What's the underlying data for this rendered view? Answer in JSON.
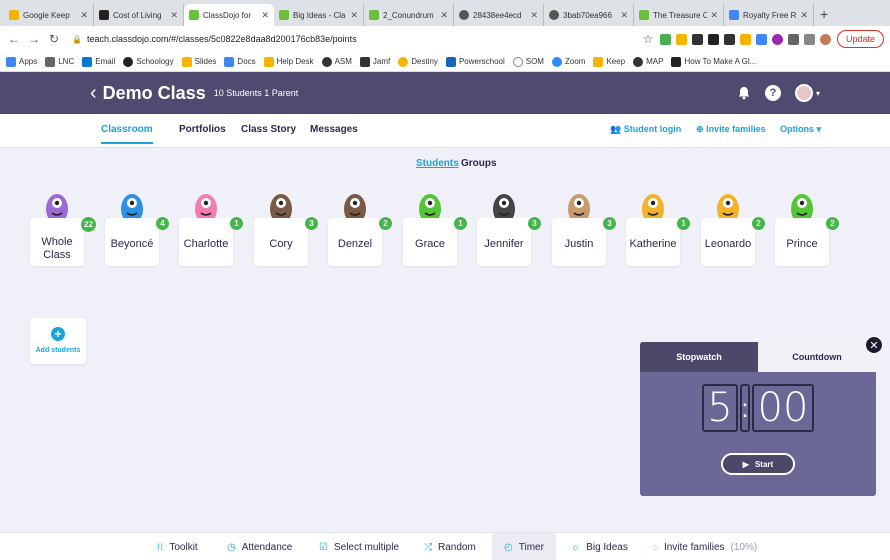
{
  "browser": {
    "tabs": [
      {
        "title": "Google Keep",
        "color": "#f4b400"
      },
      {
        "title": "Cost of Living",
        "color": "#222"
      },
      {
        "title": "ClassDojo for",
        "color": "#6bbf3b"
      },
      {
        "title": "Big Ideas - Cla",
        "color": "#6bbf3b"
      },
      {
        "title": "2_Conundrum",
        "color": "#6bbf3b"
      },
      {
        "title": "28438ee4ecd",
        "color": "#555"
      },
      {
        "title": "3bab70ea966",
        "color": "#555"
      },
      {
        "title": "The Treasure C",
        "color": "#6bbf3b"
      },
      {
        "title": "Royalty Free R",
        "color": "#4285f4"
      }
    ],
    "url": "teach.classdojo.com/#/classes/5c0822e8daa8d200176cb83e/points",
    "update_label": "Update",
    "bookmarks": [
      "Apps",
      "LNC",
      "Email",
      "Schoology",
      "Slides",
      "Docs",
      "Help Desk",
      "ASM",
      "Jamf",
      "Destiny",
      "Powerschool",
      "SOM",
      "Zoom",
      "Keep",
      "MAP",
      "How To Make A Gl..."
    ]
  },
  "header": {
    "class_name": "Demo Class",
    "meta": "10 Students  1 Parent"
  },
  "subnav": {
    "tabs": [
      "Classroom",
      "Portfolios",
      "Class Story",
      "Messages"
    ],
    "student_login": "Student login",
    "invite_families": "Invite families",
    "options": "Options"
  },
  "segments": {
    "students": "Students",
    "groups": "Groups"
  },
  "students": [
    {
      "name": "Whole Class",
      "points": "22",
      "color": "#9c6ad6"
    },
    {
      "name": "Beyoncé",
      "points": "4",
      "color": "#2f8fe0"
    },
    {
      "name": "Charlotte",
      "points": "1",
      "color": "#f07eb0"
    },
    {
      "name": "Cory",
      "points": "3",
      "color": "#7a5a44"
    },
    {
      "name": "Denzel",
      "points": "2",
      "color": "#7a5a44"
    },
    {
      "name": "Grace",
      "points": "1",
      "color": "#55c437"
    },
    {
      "name": "Jennifer",
      "points": "3",
      "color": "#444"
    },
    {
      "name": "Justin",
      "points": "3",
      "color": "#c99a6b"
    },
    {
      "name": "Katherine",
      "points": "1",
      "color": "#f2b32a"
    },
    {
      "name": "Leonardo",
      "points": "2",
      "color": "#f2b32a"
    },
    {
      "name": "Prince",
      "points": "2",
      "color": "#55c437"
    }
  ],
  "add_students": "Add students",
  "timer": {
    "stopwatch": "Stopwatch",
    "countdown": "Countdown",
    "minutes": "5",
    "seconds": "00",
    "start": "Start"
  },
  "toolbar": {
    "toolkit": "Toolkit",
    "attendance": "Attendance",
    "select_multiple": "Select multiple",
    "random": "Random",
    "timer": "Timer",
    "big_ideas": "Big Ideas",
    "invite_families": "Invite families",
    "invite_pct": "(10%)"
  }
}
